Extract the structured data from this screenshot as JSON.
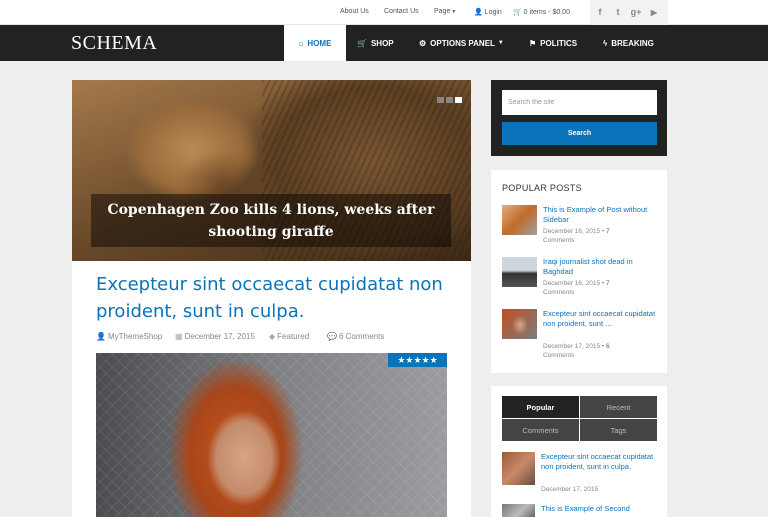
{
  "topbar": {
    "links": [
      "About Us",
      "Contact Us",
      "Page"
    ],
    "login": "Login",
    "cart": "0 items - $0.00",
    "social": [
      "f",
      "t",
      "g+",
      "▶"
    ]
  },
  "header": {
    "logo": "SCHEMA",
    "nav": [
      {
        "label": "HOME",
        "icon": "⌂"
      },
      {
        "label": "SHOP",
        "icon": "🛒"
      },
      {
        "label": "OPTIONS PANEL",
        "icon": "⚙"
      },
      {
        "label": "POLITICS",
        "icon": "⚑"
      },
      {
        "label": "BREAKING",
        "icon": "ϟ"
      }
    ]
  },
  "slider": {
    "caption": "Copenhagen Zoo kills 4 lions, weeks after shooting giraffe"
  },
  "post": {
    "title": "Excepteur sint occaecat cupidatat non proident, sunt in culpa.",
    "author": "MyThemeShop",
    "date": "December 17, 2015",
    "category": "Featured",
    "comments": "6 Comments",
    "rating": "★★★★★"
  },
  "search": {
    "placeholder": "Search the site",
    "button": "Search"
  },
  "popular": {
    "title": "POPULAR POSTS",
    "posts": [
      {
        "title": "This is Example of Post without Sidebar",
        "date": "December 16, 2015",
        "count": "7",
        "sub": "Comments"
      },
      {
        "title": "Iraqi journalist shot dead in Baghdad",
        "date": "December 16, 2015",
        "count": "7",
        "sub": "Comments"
      },
      {
        "title": "Excepteur sint occaecat cupidatat non proident, sunt ...",
        "date": "December 17, 2015",
        "count": "6",
        "sub": "Comments"
      }
    ]
  },
  "tabs": {
    "labels": [
      "Popular",
      "Recent",
      "Comments",
      "Tags"
    ],
    "posts": [
      {
        "title": "Excepteur sint occaecat cupidatat non proident, sunt in culpa.",
        "date": "December 17, 2015"
      },
      {
        "title": "This is Example of Second"
      }
    ]
  },
  "colors": {
    "accent": "#0a73b9",
    "header_bg": "#222222",
    "page_bg": "#eeeeee"
  }
}
